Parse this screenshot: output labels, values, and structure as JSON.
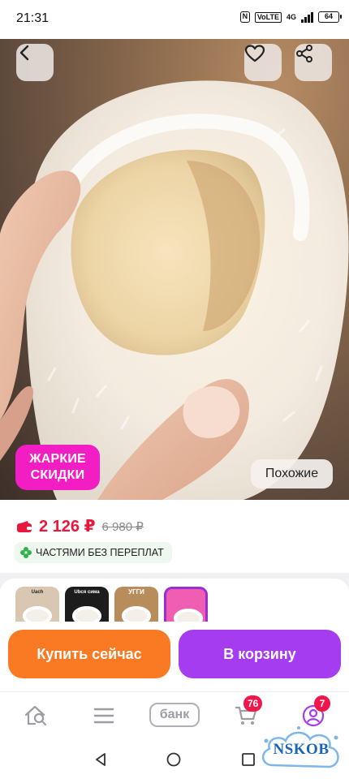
{
  "status_bar": {
    "time": "21:31",
    "nfc": "N",
    "volte": "VoLTE",
    "network": "4G",
    "battery": "64"
  },
  "product": {
    "promo_badge_line1": "ЖАРКИЕ",
    "promo_badge_line2": "СКИДКИ",
    "similar_label": "Похожие",
    "price_current": "2 126 ₽",
    "price_old": "6 980 ₽",
    "installment_label": "ЧАСТЯМИ БЕЗ ПЕРЕПЛАТ"
  },
  "variants": [
    {
      "label": "Uach"
    },
    {
      "label": "Ubcя сима"
    },
    {
      "label": "УГГИ"
    },
    {
      "label": ""
    }
  ],
  "actions": {
    "buy_now": "Купить сейчас",
    "add_to_cart": "В корзину"
  },
  "bottom_nav": {
    "bank_label": "банк",
    "cart_count": "76",
    "profile_count": "7"
  },
  "watermark": {
    "text": "NSKOB"
  },
  "icons": {
    "back": "chevron-left-icon",
    "favorite": "heart-icon",
    "share": "share-icon",
    "wallet": "wallet-icon",
    "installment": "plus-icon",
    "home": "home-search-icon",
    "catalog": "menu-icon",
    "cart": "cart-icon",
    "profile": "profile-icon"
  },
  "colors": {
    "price": "#e8173b",
    "promo_badge": "#f21ec4",
    "buy_now": "#fa7a24",
    "add_to_cart": "#a63cf0",
    "badge": "#f0164a",
    "installment_green": "#2fb34a"
  }
}
